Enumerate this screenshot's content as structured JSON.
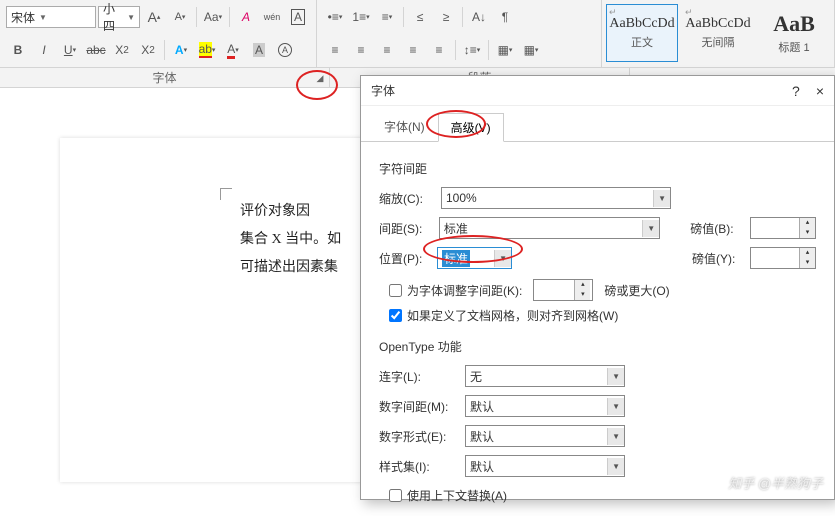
{
  "ribbon": {
    "font_name": "宋体",
    "font_size": "小四",
    "grow": "A",
    "shrink": "A",
    "caseBtn": "Aa",
    "clearFmt": "A",
    "phonetic": "wén",
    "charBorder": "A",
    "bold": "B",
    "italic": "I",
    "underline": "U",
    "strike": "abc",
    "sub": "X",
    "sup": "X",
    "textfx": "A",
    "highlight": "ab",
    "fontcolor": "A",
    "charshade": "A",
    "ring": "A"
  },
  "para": {
    "bullet": "•≡",
    "number": "1≡",
    "multi": "≡",
    "indentL": "≤",
    "indentR": "≥",
    "sort": "A↓",
    "showmarks": "¶",
    "alignL": "≡",
    "alignC": "≡",
    "alignR": "≡",
    "alignJ": "≡",
    "distribute": "≡",
    "linesp": "↕≡",
    "shade": "▦",
    "border": "▦"
  },
  "styles": [
    {
      "sample": "AaBbCcDd",
      "name": "正文",
      "corner": "↵",
      "big": false,
      "sel": true
    },
    {
      "sample": "AaBbCcDd",
      "name": "无间隔",
      "corner": "↵",
      "big": false,
      "sel": false
    },
    {
      "sample": "AaB",
      "name": "标题 1",
      "corner": "",
      "big": true,
      "sel": false
    }
  ],
  "group_labels": {
    "font": "字体",
    "para": "段落"
  },
  "doc_lines": [
    "评价对象因",
    "集合 X 当中。如",
    "可描述出因素集"
  ],
  "dialog": {
    "title": "字体",
    "help": "?",
    "close": "×",
    "tabs": {
      "font": "字体(N)",
      "advanced": "高级(V)"
    },
    "spacing": {
      "title": "字符间距",
      "scale_label": "缩放(C):",
      "scale_value": "100%",
      "spacing_label": "间距(S):",
      "spacing_value": "标准",
      "spacing_pt_label": "磅值(B):",
      "position_label": "位置(P):",
      "position_value": "标准",
      "position_pt_label": "磅值(Y):",
      "kerning_chk": "为字体调整字间距(K):",
      "kerning_unit": "磅或更大(O)",
      "snap_chk": "如果定义了文档网格，则对齐到网格(W)"
    },
    "opentype": {
      "title": "OpenType 功能",
      "ligatures_label": "连字(L):",
      "ligatures_value": "无",
      "numspacing_label": "数字间距(M):",
      "numspacing_value": "默认",
      "numform_label": "数字形式(E):",
      "numform_value": "默认",
      "styleset_label": "样式集(I):",
      "styleset_value": "默认",
      "contextual_chk": "使用上下文替换(A)"
    }
  },
  "watermark": "知乎 @半熟狗子"
}
